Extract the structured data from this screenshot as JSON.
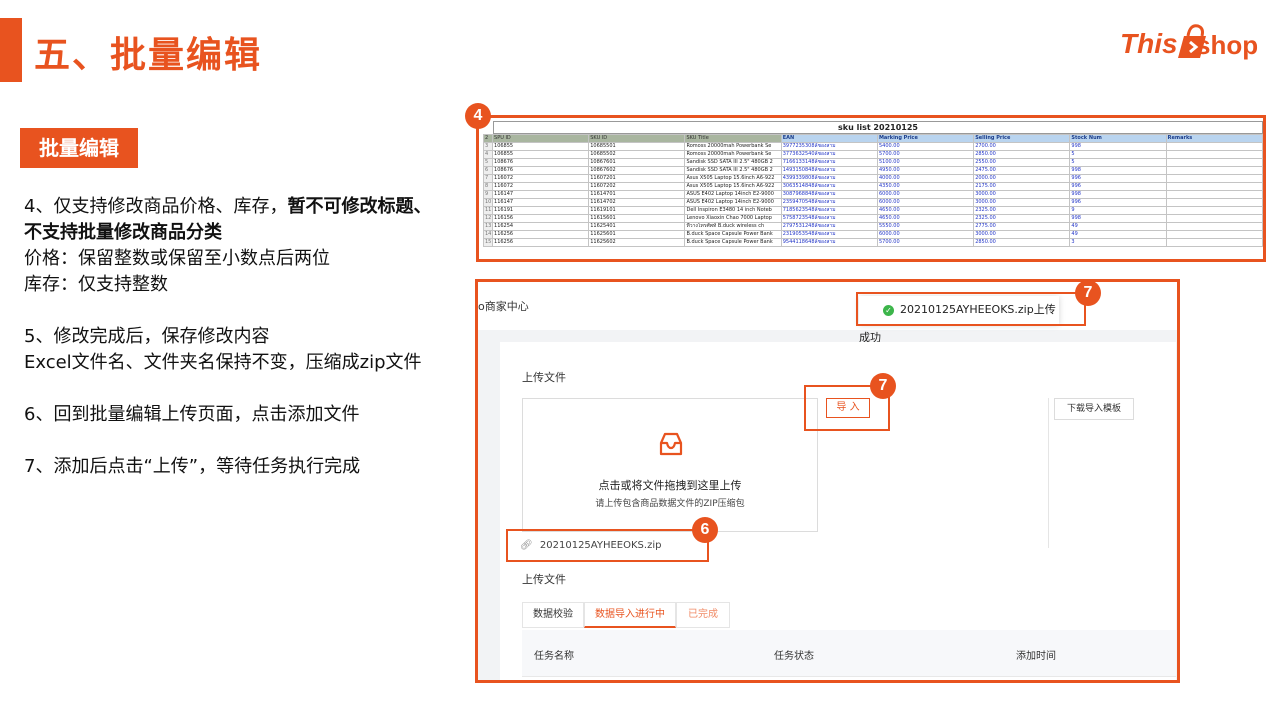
{
  "header": {
    "title": "五、批量编辑",
    "logo_left": "This",
    "logo_right": "shop"
  },
  "section_tag": "批量编辑",
  "steps": {
    "s4_line1_normal": "4、仅支持修改商品价格、库存，",
    "s4_line1_bold": "暂不可修改标题、",
    "s4_line2_bold": "不支持批量修改商品分类",
    "s4_price": "价格：保留整数或保留至小数点后两位",
    "s4_stock": "库存：仅支持整数",
    "s5_line1": "5、修改完成后，保存修改内容",
    "s5_line2": "Excel文件名、文件夹名保持不变，压缩成zip文件",
    "s6": "6、回到批量编辑上传页面，点击添加文件",
    "s7": "7、添加后点击“上传”，等待任务执行完成"
  },
  "badges": {
    "excel": "4",
    "toast": "7",
    "import": "7",
    "file": "6"
  },
  "sheet": {
    "title": "sku list 20210125",
    "columns": [
      "SPU ID",
      "SKU ID",
      "SKU Title",
      "EAN",
      "Marking Price",
      "Selling Price",
      "Stock Num",
      "Remarks"
    ],
    "rows": [
      {
        "n": "3",
        "c": [
          "106855",
          "10685501",
          "Romoss 20000mah Powerbank Se",
          "3977235308ล้ชองสาม",
          "5400.00",
          "2700.00",
          "998",
          ""
        ]
      },
      {
        "n": "4",
        "c": [
          "106855",
          "10685502",
          "Romoss 20000mah Powerbank Se",
          "3773632540ล้ชองสาม",
          "5700.00",
          "2850.00",
          "5",
          ""
        ]
      },
      {
        "n": "5",
        "c": [
          "108676",
          "10867601",
          "Sandisk SSD SATA III 2.5\" 480GB 2",
          "7166133148ล้ชองสาม",
          "5100.00",
          "2550.00",
          "5",
          ""
        ]
      },
      {
        "n": "6",
        "c": [
          "108676",
          "10867602",
          "Sandisk SSD SATA III 2.5\" 480GB 2",
          "1493150848ล้ชองสาม",
          "4950.00",
          "2475.00",
          "998",
          ""
        ]
      },
      {
        "n": "7",
        "c": [
          "116072",
          "11607201",
          "Asus X505 Laptop 15.6inch A6-922",
          "4399339808ล้ชองสาม",
          "4000.00",
          "2000.00",
          "996",
          ""
        ]
      },
      {
        "n": "8",
        "c": [
          "116072",
          "11607202",
          "Asus X505 Laptop 15.6inch A6-922",
          "3063514848ล้ชองสาม",
          "4350.00",
          "2175.00",
          "996",
          ""
        ]
      },
      {
        "n": "9",
        "c": [
          "116147",
          "11614701",
          "ASUS E402 Laptop 14inch E2-9000",
          "3087968848ล้ชองสาม",
          "6000.00",
          "3000.00",
          "998",
          ""
        ]
      },
      {
        "n": "10",
        "c": [
          "116147",
          "11614702",
          "ASUS E402 Laptop 14inch E2-9000",
          "2359470548ล้ชองสาม",
          "6000.00",
          "3000.00",
          "996",
          ""
        ]
      },
      {
        "n": "11",
        "c": [
          "116191",
          "11619101",
          "Dell Inspiron E3480 14 inch Noteb",
          "7185623548ล้ชองสาม",
          "4650.00",
          "2325.00",
          "9",
          ""
        ]
      },
      {
        "n": "12",
        "c": [
          "116156",
          "11615601",
          "Lenovo Xiaoxin Chao 7000 Laptop",
          "5758723548ล้ชองสาม",
          "4650.00",
          "2325.00",
          "998",
          ""
        ]
      },
      {
        "n": "13",
        "c": [
          "116254",
          "11625401",
          "ที่วางโทรศัพท์ B.duck wireless ch",
          "2797531248ล้ชองสาม",
          "5550.00",
          "2775.00",
          "49",
          ""
        ]
      },
      {
        "n": "14",
        "c": [
          "116256",
          "11625601",
          "B.duck Space Capsule Power Bank",
          "2319053548ล้ชองสาม",
          "6000.00",
          "3000.00",
          "49",
          ""
        ]
      },
      {
        "n": "15",
        "c": [
          "116256",
          "11625602",
          "B.duck Space Capsule Power Bank",
          "9544118648ล้ชองสาม",
          "5700.00",
          "2850.00",
          "3",
          ""
        ]
      }
    ]
  },
  "upload_ui": {
    "merchant": "o商家中心",
    "toast": "20210125AYHEEOKS.zip上传成功",
    "upload_file_label": "上传文件",
    "import_button": "导 入",
    "template_button": "下载导入模板",
    "drop_main": "点击或将文件拖拽到这里上传",
    "drop_sub": "请上传包含商品数据文件的ZIP压缩包",
    "file_name": "20210125AYHEEOKS.zip",
    "upload_file_label2": "上传文件",
    "tabs": [
      "数据校验",
      "数据导入进行中",
      "已完成"
    ],
    "table_headers": [
      "任务名称",
      "任务状态",
      "添加时间"
    ]
  },
  "colors": {
    "accent": "#e8531f",
    "success": "#3cb54a",
    "link_blue": "#2336c8"
  }
}
